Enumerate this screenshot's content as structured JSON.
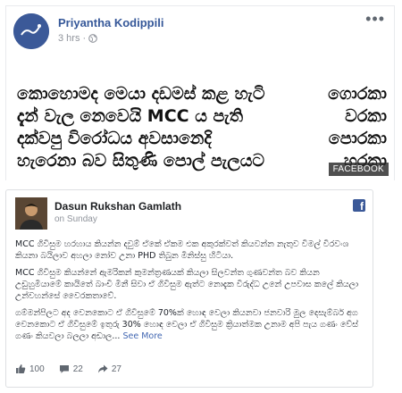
{
  "post1": {
    "author": "Priyantha Kodippili",
    "time": "3 hrs",
    "watermark": "FACEBOOK",
    "poem_lines": [
      [
        "කොහොමද මෙයා දඩමස් කළ හැටි",
        "ගොරකා"
      ],
      [
        "දැන් වැල නෙවෙයි MCC ය පැති",
        "වරකා"
      ],
      [
        "දක්වපු විරෝධය අවසානෙදි",
        "පොරකා"
      ],
      [
        "හැරෙනා බව සිතුණි පොල් පැලයට",
        "හරකා"
      ]
    ]
  },
  "post2": {
    "author": "Dasun Rukshan Gamlath",
    "time": "on Sunday",
    "paragraphs": [
      "MCC ගිවිසුම හරහාය කියන්න දවුම් ඒකේ ඒකම එක අකුරක්වත් කියවන්න නැතුව විමල් විරවංශ කියනා බයිලාව අහලා නෝව උනා PHD තිබුන මිනිස්සු හිටියා.",
      "MCC ගිවිසුම කියන්නේ ඇමරිකන් කුමන්ත්‍රණයක් කියලා සිලවන්ත ගුණවන්ත බව කියන උඩුහුමියාමේ කායිතේ බාංචි මිනී සිවා ඒ ගිවිසුම ඇත්ට නොදැක විරුද්ධ උනේ උපවාස කලේ කියලා උන්වහන්සේ වෛරකතාවේ.",
      "ගම්මන්පිලට අද වෙනකොට ඒ ගිවිසුමේ 70%ක් හොඳ වෙලා කියනවා ජනවාරි මුල දෙසැම්බර් අග වෙනකොට ඒ ගිවිසුමේ ඉතුරු 30% හොඳ වෙලා ඒ ගිවිසුම ක්‍රියාත්මක උනාම අපි පැය ගණං වේස් ගණං කියවලා බලලා අඩාල..."
    ],
    "see_more": "See More",
    "likes": "100",
    "comments": "22",
    "shares": "27"
  }
}
